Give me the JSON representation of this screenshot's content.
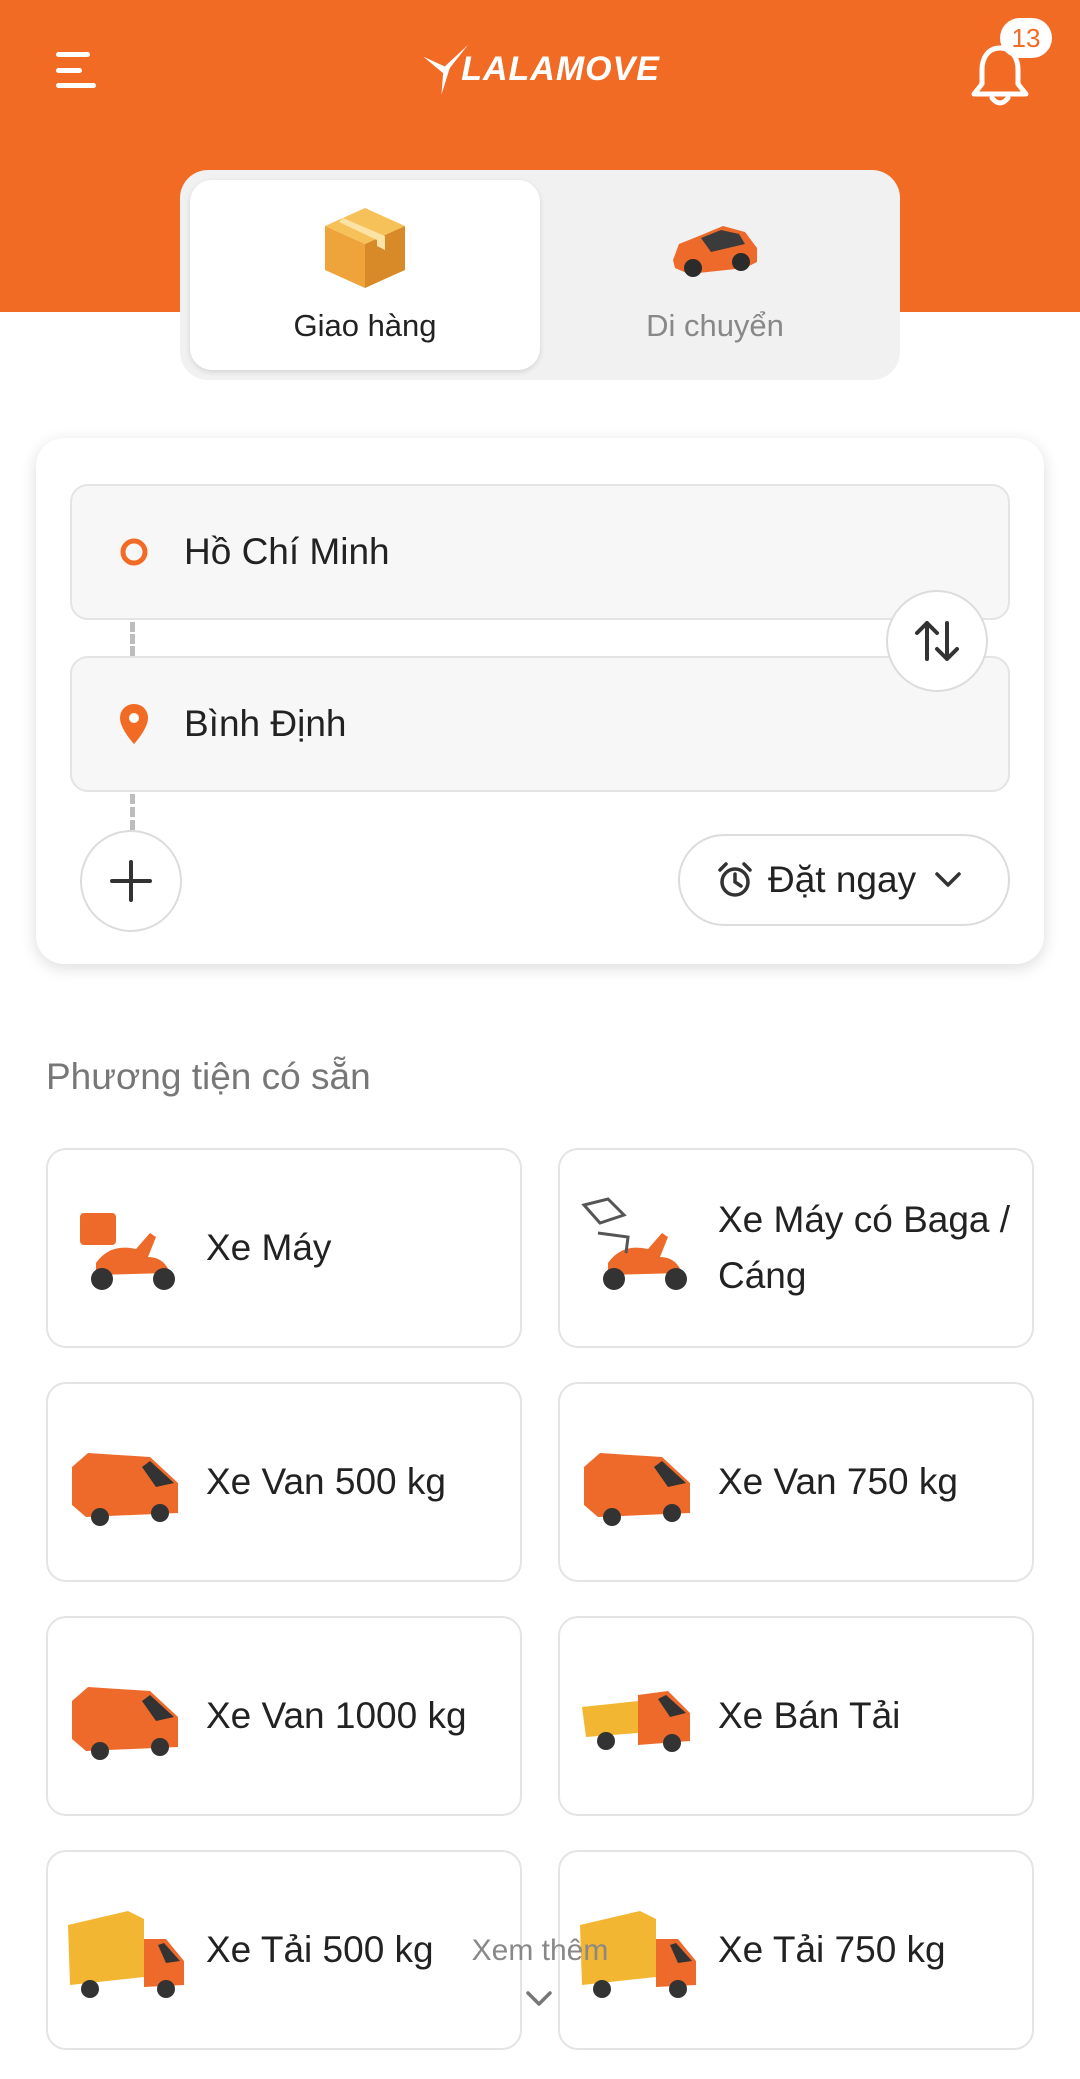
{
  "header": {
    "brand": "LALAMOVE",
    "notification_count": "13"
  },
  "modes": [
    {
      "label": "Giao hàng",
      "icon": "package-box-icon",
      "active": true
    },
    {
      "label": "Di chuyển",
      "icon": "car-icon",
      "active": false
    }
  ],
  "route": {
    "from": "Hồ Chí Minh",
    "to": "Bình Định",
    "schedule_label": "Đặt ngay"
  },
  "vehicles_title": "Phương tiện có sẵn",
  "vehicles": [
    {
      "label": "Xe Máy",
      "icon": "motorbike-icon"
    },
    {
      "label": "Xe Máy có Baga / Cáng",
      "icon": "motorbike-rack-icon"
    },
    {
      "label": "Xe Van 500 kg",
      "icon": "van-icon"
    },
    {
      "label": "Xe Van 750 kg",
      "icon": "van-icon"
    },
    {
      "label": "Xe Van 1000 kg",
      "icon": "van-icon"
    },
    {
      "label": "Xe Bán Tải",
      "icon": "pickup-truck-icon"
    },
    {
      "label": "Xe Tải 500 kg",
      "icon": "box-truck-icon"
    },
    {
      "label": "Xe Tải 750 kg",
      "icon": "box-truck-icon"
    }
  ],
  "see_more": "Xem thêm",
  "colors": {
    "brand_orange": "#f26b25",
    "truck_yellow": "#f2b632"
  }
}
